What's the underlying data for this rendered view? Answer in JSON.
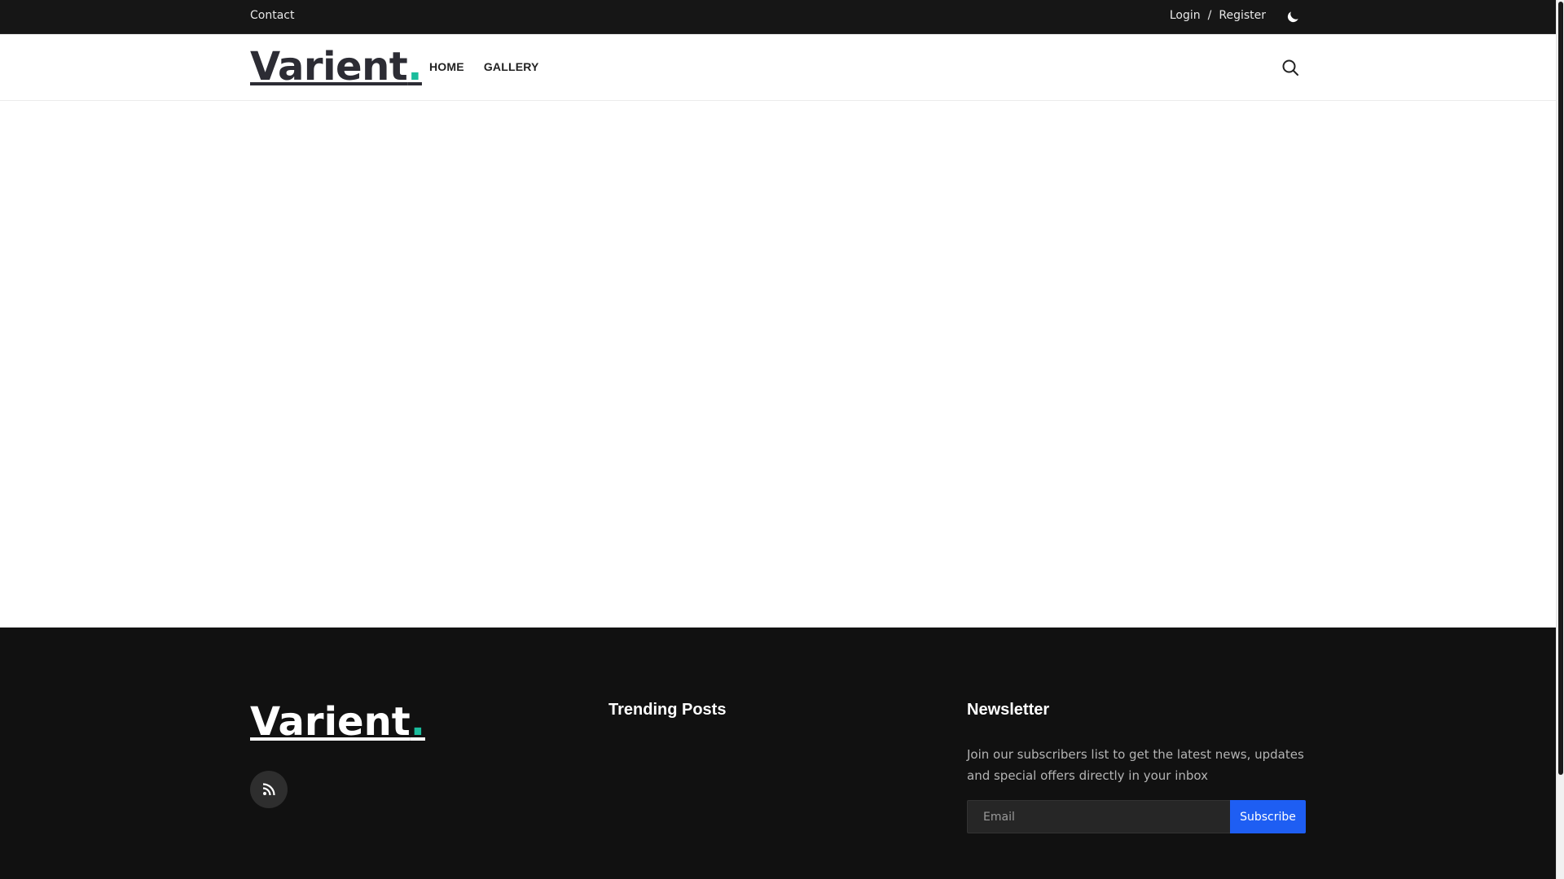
{
  "topbar": {
    "contact_label": "Contact",
    "login_label": "Login",
    "separator": "/",
    "register_label": "Register",
    "theme_icon": "moon-icon"
  },
  "header": {
    "logo_text": "Varient",
    "logo_dot": ".",
    "nav": [
      "HOME",
      "GALLERY"
    ],
    "search_icon": "search-icon"
  },
  "footer": {
    "logo_text": "Varient",
    "logo_dot": ".",
    "rss_icon": "rss-icon",
    "trending_title": "Trending Posts",
    "newsletter_title": "Newsletter",
    "newsletter_text": "Join our subscribers list to get the latest news, updates and special offers directly in your inbox",
    "email_placeholder": "Email",
    "subscribe_label": "Subscribe"
  },
  "colors": {
    "accent_dot": "#1abc9c",
    "subscribe_button": "#1e5ef3",
    "topbar_bg": "#161616",
    "footer_bg": "#111111"
  }
}
